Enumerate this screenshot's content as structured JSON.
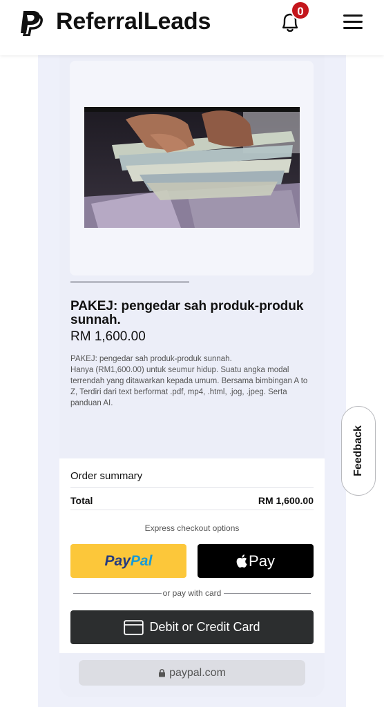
{
  "header": {
    "brand": "ReferralLeads",
    "notification_count": "0"
  },
  "product": {
    "title": "PAKEJ: pengedar sah produk-produk sunnah.",
    "price": "RM 1,600.00",
    "description": "PAKEJ: pengedar sah produk-produk sunnah.\nHanya (RM1,600.00) untuk seumur hidup. Suatu angka modal terrendah yang ditawarkan kepada umum. Bersama bimbingan A to Z, Terdiri dari text berformat .pdf, mp4, .html, .jog, .jpeg. Serta panduan AI.",
    "image_progress": 0.49
  },
  "checkout": {
    "order_summary": "Order summary",
    "total_label": "Total",
    "total_value": "RM 1,600.00",
    "express_label": "Express checkout options",
    "paypal_part1": "Pay",
    "paypal_part2": "Pal",
    "apple_pay_label": "Pay",
    "or_card": "or pay with card",
    "card_button": "Debit or Credit Card"
  },
  "browser": {
    "url": "paypal.com"
  },
  "feedback": {
    "label": "Feedback"
  },
  "colors": {
    "paypal_yellow": "#fcc73a",
    "paypal_dark_blue": "#253b80",
    "paypal_light_blue": "#179bd7",
    "badge_red": "#c4161c",
    "card_button": "#2c2e2f"
  },
  "icons": [
    "paypal-logo-icon",
    "bell-icon",
    "hamburger-menu-icon",
    "apple-icon",
    "credit-card-icon",
    "lock-icon"
  ]
}
